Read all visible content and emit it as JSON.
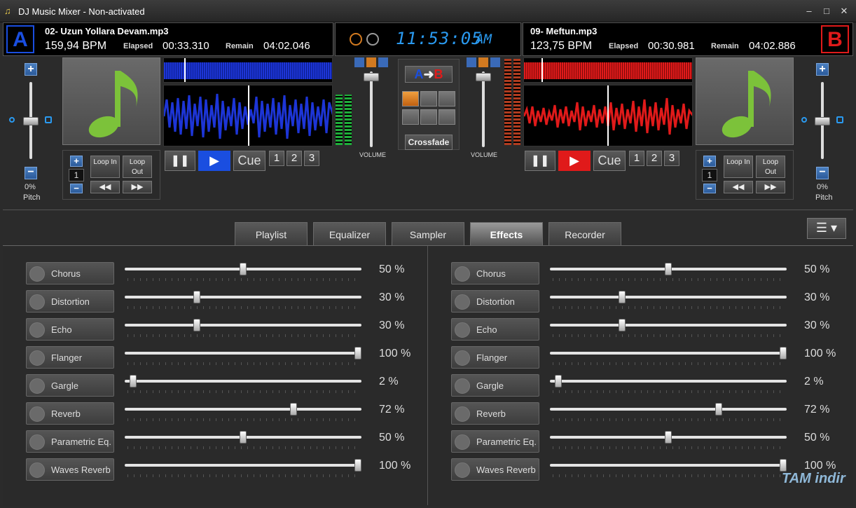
{
  "window": {
    "title": "DJ Music Mixer - Non-activated",
    "minimize": "–",
    "maximize": "□",
    "close": "✕"
  },
  "clock": {
    "time": "11:53:05",
    "ampm": "AM"
  },
  "deck_a": {
    "letter": "A",
    "track": "02- Uzun Yollara Devam.mp3",
    "bpm": "159,94 BPM",
    "elapsed_label": "Elapsed",
    "elapsed": "00:33.310",
    "remain_label": "Remain",
    "remain": "04:02.046",
    "pitch_value": "0%",
    "pitch_label": "Pitch",
    "loop_count": "1",
    "loop_in": "Loop In",
    "loop_out": "Loop Out",
    "cue": "Cue",
    "hotcues": [
      "1",
      "2",
      "3"
    ],
    "volume_label": "VOLUME",
    "accent": "#1a4ee0"
  },
  "deck_b": {
    "letter": "B",
    "track": "09- Meftun.mp3",
    "bpm": "123,75 BPM",
    "elapsed_label": "Elapsed",
    "elapsed": "00:30.981",
    "remain_label": "Remain",
    "remain": "04:02.886",
    "pitch_value": "0%",
    "pitch_label": "Pitch",
    "loop_count": "1",
    "loop_in": "Loop In",
    "loop_out": "Loop Out",
    "cue": "Cue",
    "hotcues": [
      "1",
      "2",
      "3"
    ],
    "volume_label": "VOLUME",
    "accent": "#e01a1a"
  },
  "crossfade": {
    "ab_a": "A",
    "ab_b": "B",
    "button": "Crossfade"
  },
  "tabs": [
    "Playlist",
    "Equalizer",
    "Sampler",
    "Effects",
    "Recorder"
  ],
  "active_tab": "Effects",
  "effects_left": [
    {
      "name": "Chorus",
      "value": 50,
      "label": "50 %"
    },
    {
      "name": "Distortion",
      "value": 30,
      "label": "30 %"
    },
    {
      "name": "Echo",
      "value": 30,
      "label": "30 %"
    },
    {
      "name": "Flanger",
      "value": 100,
      "label": "100 %"
    },
    {
      "name": "Gargle",
      "value": 2,
      "label": "2 %"
    },
    {
      "name": "Reverb",
      "value": 72,
      "label": "72 %"
    },
    {
      "name": "Parametric Eq.",
      "value": 50,
      "label": "50 %"
    },
    {
      "name": "Waves Reverb",
      "value": 100,
      "label": "100 %"
    }
  ],
  "effects_right": [
    {
      "name": "Chorus",
      "value": 50,
      "label": "50 %"
    },
    {
      "name": "Distortion",
      "value": 30,
      "label": "30 %"
    },
    {
      "name": "Echo",
      "value": 30,
      "label": "30 %"
    },
    {
      "name": "Flanger",
      "value": 100,
      "label": "100 %"
    },
    {
      "name": "Gargle",
      "value": 2,
      "label": "2 %"
    },
    {
      "name": "Reverb",
      "value": 72,
      "label": "72 %"
    },
    {
      "name": "Parametric Eq.",
      "value": 50,
      "label": "50 %"
    },
    {
      "name": "Waves Reverb",
      "value": 100,
      "label": "100 %"
    }
  ],
  "watermark": "TAM indir"
}
